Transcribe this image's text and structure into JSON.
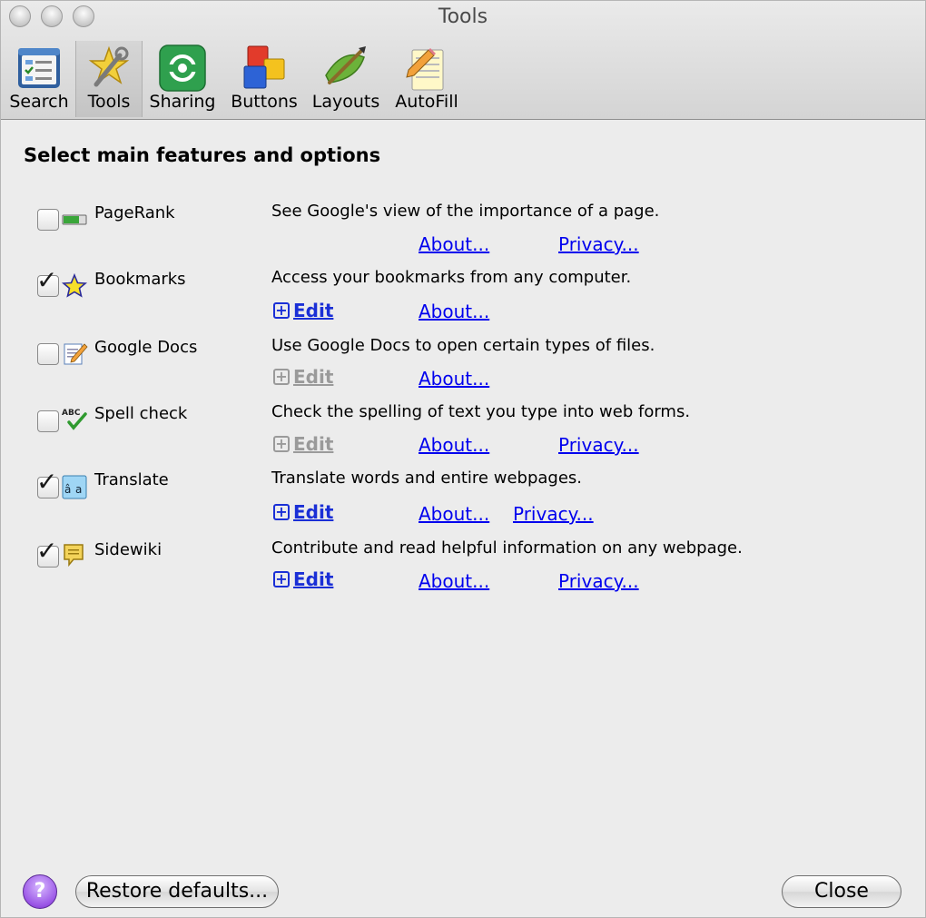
{
  "window": {
    "title": "Tools"
  },
  "toolbar": {
    "items": [
      {
        "label": "Search",
        "icon": "search-prefs-icon",
        "selected": false
      },
      {
        "label": "Tools",
        "icon": "tools-icon",
        "selected": true
      },
      {
        "label": "Sharing",
        "icon": "sharing-icon",
        "selected": false
      },
      {
        "label": "Buttons",
        "icon": "buttons-icon",
        "selected": false
      },
      {
        "label": "Layouts",
        "icon": "layouts-icon",
        "selected": false
      },
      {
        "label": "AutoFill",
        "icon": "autofill-icon",
        "selected": false
      }
    ]
  },
  "main": {
    "heading": "Select main features and options",
    "features": [
      {
        "name": "PageRank",
        "checked": false,
        "icon": "pagerank-icon",
        "description": "See Google's view of the importance of a page.",
        "edit": null,
        "about": "About...",
        "privacy": "Privacy..."
      },
      {
        "name": "Bookmarks",
        "checked": true,
        "icon": "star-icon",
        "description": "Access your bookmarks from any computer.",
        "edit": {
          "label": "Edit",
          "enabled": true
        },
        "about": "About...",
        "privacy": null
      },
      {
        "name": "Google Docs",
        "checked": false,
        "icon": "docs-icon",
        "description": "Use Google Docs to open certain types of files.",
        "edit": {
          "label": "Edit",
          "enabled": false
        },
        "about": "About...",
        "privacy": null
      },
      {
        "name": "Spell check",
        "checked": false,
        "icon": "spellcheck-icon",
        "description": "Check the spelling of text you type into web forms.",
        "edit": {
          "label": "Edit",
          "enabled": false
        },
        "about": "About...",
        "privacy": "Privacy..."
      },
      {
        "name": "Translate",
        "checked": true,
        "icon": "translate-icon",
        "description": "Translate words and entire webpages.",
        "edit": {
          "label": "Edit",
          "enabled": true
        },
        "about": "About...",
        "privacy": "Privacy..."
      },
      {
        "name": "Sidewiki",
        "checked": true,
        "icon": "sidewiki-icon",
        "description": "Contribute and read helpful information on any webpage.",
        "edit": {
          "label": "Edit",
          "enabled": true
        },
        "about": "About...",
        "privacy": "Privacy..."
      }
    ]
  },
  "footer": {
    "help_label": "?",
    "restore_label": "Restore defaults...",
    "close_label": "Close"
  },
  "colors": {
    "link": "#0000ee",
    "edit": "#1a2fd6",
    "disabled": "#9a9a9a",
    "help": "#9a55e6"
  }
}
